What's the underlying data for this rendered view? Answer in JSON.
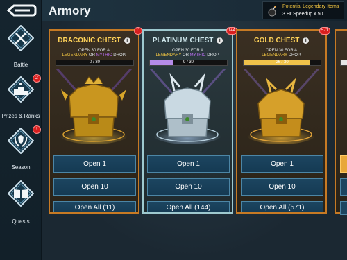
{
  "header": {
    "title": "Armory",
    "legendary": {
      "title": "Potential Legendary Items",
      "subtitle": "3 Hr Speedup x 50"
    }
  },
  "sidebar": {
    "items": [
      {
        "label": "Battle",
        "badge": ""
      },
      {
        "label": "Prizes & Ranks",
        "badge": "2"
      },
      {
        "label": "Season",
        "badge": "!"
      },
      {
        "label": "Quests",
        "badge": ""
      }
    ]
  },
  "cards": [
    {
      "title": "DRACONIC CHEST",
      "info": "i",
      "desc_line1": "OPEN 30 FOR A",
      "desc_leg": "LEGENDARY",
      "desc_or": " OR ",
      "desc_myth": "MYTHIC",
      "desc_drop": " DROP.",
      "progress_text": "0 / 30",
      "progress": 0.0,
      "badge": "11",
      "buttons": [
        "Open 1",
        "Open 10",
        "Open All (11)"
      ]
    },
    {
      "title": "PLATINUM CHEST",
      "info": "i",
      "desc_line1": "OPEN 30 FOR A",
      "desc_leg": "LEGENDARY",
      "desc_or": " OR ",
      "desc_myth": "MYTHIC",
      "desc_drop": " DROP.",
      "progress_text": "9 / 30",
      "progress": 0.3,
      "badge": "144",
      "buttons": [
        "Open 1",
        "Open 10",
        "Open All (144)"
      ]
    },
    {
      "title": "GOLD CHEST",
      "info": "i",
      "desc_line1": "OPEN 30 FOR A",
      "desc_leg": "LEGENDARY",
      "desc_or": "",
      "desc_myth": "",
      "desc_drop": " DROP.",
      "progress_text": "26 / 30",
      "progress": 0.867,
      "badge": "571",
      "buttons": [
        "Open 1",
        "Open 10",
        "Open All (571)"
      ]
    }
  ],
  "colors": {
    "draconic_border": "#c77a24",
    "platinum_border": "#9ec9cf",
    "gold_title": "#ffd35a",
    "progress_platinum": "#b58be8",
    "progress_gold": "#f0c24a",
    "button_blue": "#1c4560",
    "badge_red": "#d81f1f"
  },
  "icons": {
    "back": "back-arrow-icon",
    "battle": "crossed-swords-icon",
    "prizes": "podium-icon",
    "season": "laurel-crest-icon",
    "quests": "open-book-icon",
    "legendary": "bomb-icon"
  }
}
